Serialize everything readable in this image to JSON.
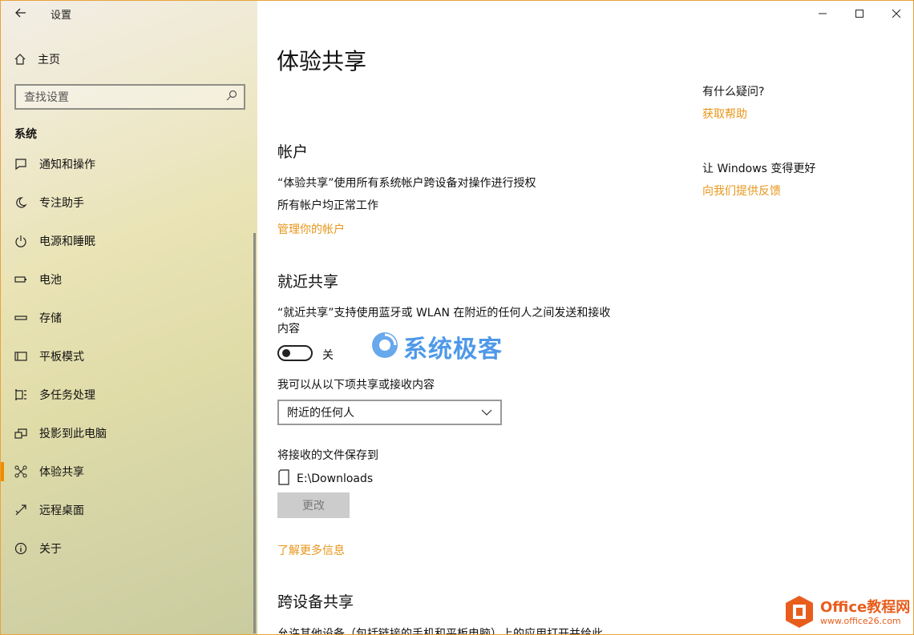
{
  "window": {
    "title": "设置",
    "controls": {
      "minimize": "—",
      "maximize": "☐",
      "close": "✕"
    }
  },
  "sidebar": {
    "home_label": "主页",
    "search_placeholder": "查找设置",
    "section": "系统",
    "items": [
      {
        "label": "通知和操作",
        "icon": "notification-icon"
      },
      {
        "label": "专注助手",
        "icon": "moon-icon"
      },
      {
        "label": "电源和睡眠",
        "icon": "power-icon"
      },
      {
        "label": "电池",
        "icon": "battery-icon"
      },
      {
        "label": "存储",
        "icon": "storage-icon"
      },
      {
        "label": "平板模式",
        "icon": "tablet-icon"
      },
      {
        "label": "多任务处理",
        "icon": "multitask-icon"
      },
      {
        "label": "投影到此电脑",
        "icon": "projection-icon"
      },
      {
        "label": "体验共享",
        "icon": "share-icon",
        "active": true
      },
      {
        "label": "远程桌面",
        "icon": "remote-icon"
      },
      {
        "label": "关于",
        "icon": "info-icon"
      }
    ]
  },
  "main": {
    "title": "体验共享",
    "accounts": {
      "heading": "帐户",
      "desc": "“体验共享”使用所有系统帐户跨设备对操作进行授权",
      "status": "所有帐户均正常工作",
      "link": "管理你的帐户"
    },
    "nearby": {
      "heading": "就近共享",
      "desc_line1": "“就近共享”支持使用蓝牙或 WLAN 在附近的任何人之间发送和接收",
      "desc_line2": "内容",
      "toggle_label": "关",
      "share_from_label": "我可以从以下项共享或接收内容",
      "share_from_value": "附近的任何人",
      "save_label": "将接收的文件保存到",
      "save_path": "E:\\Downloads",
      "change_button": "更改",
      "learn_more": "了解更多信息"
    },
    "cross_device": {
      "heading": "跨设备共享",
      "desc_partial": "允许其他设备（包括链接的手机和平板电脑）上的应用打开并给此"
    }
  },
  "right": {
    "question": "有什么疑问?",
    "help_link": "获取帮助",
    "improve": "让 Windows 变得更好",
    "feedback_link": "向我们提供反馈"
  },
  "watermarks": {
    "site1": "系统极客",
    "site2_title": "Office教程网",
    "site2_url": "www.office26.com"
  },
  "colors": {
    "accent": "#e8961a",
    "active_indicator": "#f08c00",
    "window_border": "#e8a23c"
  }
}
